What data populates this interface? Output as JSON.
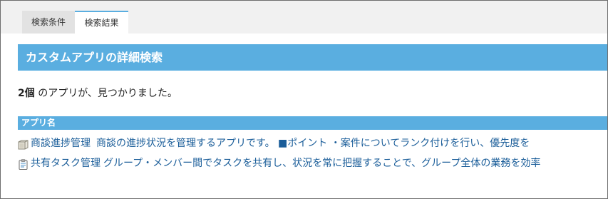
{
  "tabs": [
    {
      "label": "検索条件",
      "selected": false
    },
    {
      "label": "検索結果",
      "selected": true
    }
  ],
  "panel": {
    "title": "カスタムアプリの詳細検索"
  },
  "results": {
    "count": "2個",
    "message": " のアプリが、見つかりました。"
  },
  "table": {
    "column_header": "アプリ名",
    "rows": [
      {
        "icon": "folder-app-icon",
        "name": "商談進捗管理",
        "description": "商談の進捗状況を管理するアプリです。 ■ポイント ・案件についてランク付けを行い、優先度を"
      },
      {
        "icon": "clipboard-app-icon",
        "name": "共有タスク管理",
        "description": "グループ・メンバー間でタスクを共有し、状況を常に把握することで、グループ全体の業務を効率"
      }
    ]
  },
  "colors": {
    "accent": "#5aaee0",
    "link": "#1a5d99",
    "tab_inactive": "#e2e2e2",
    "tabbar_bg": "#f1f1f1"
  }
}
